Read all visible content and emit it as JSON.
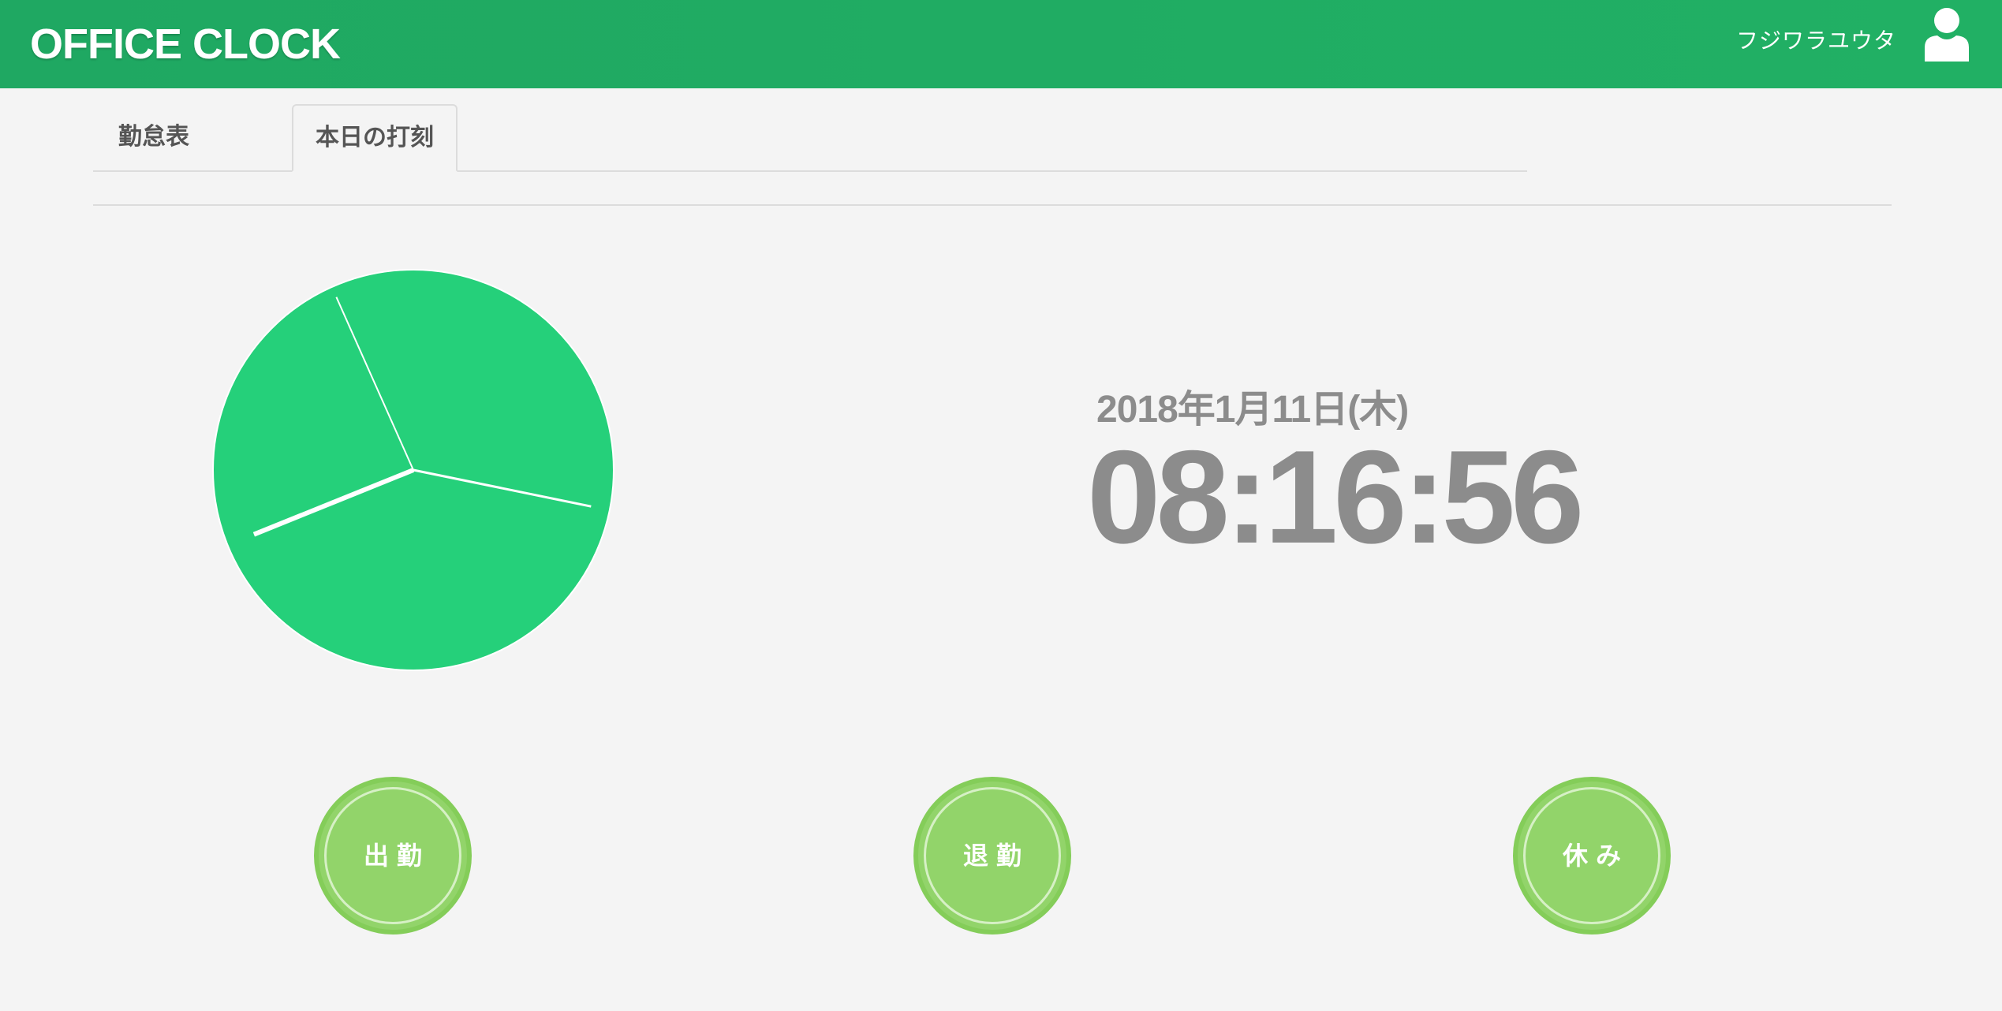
{
  "header": {
    "title": "OFFICE CLOCK",
    "user_name": "フジワラユウタ",
    "avatar_icon": "user-icon"
  },
  "tabs": [
    {
      "label": "勤怠表"
    },
    {
      "label": "本日の打刻",
      "active": true
    }
  ],
  "clock": {
    "date": "2018年1月11日(木)",
    "time": "08:16:56",
    "hours": 8,
    "minutes": 16,
    "seconds": 56
  },
  "actions": [
    {
      "label": "出勤"
    },
    {
      "label": "退勤"
    },
    {
      "label": "休み"
    }
  ],
  "colors": {
    "header_bg": "#21ae63",
    "clock_face": "#25d07a",
    "button_bg": "#92d46a",
    "button_border": "#84cd59",
    "text_gray": "#8c8c8c",
    "page_bg": "#f4f4f4"
  }
}
